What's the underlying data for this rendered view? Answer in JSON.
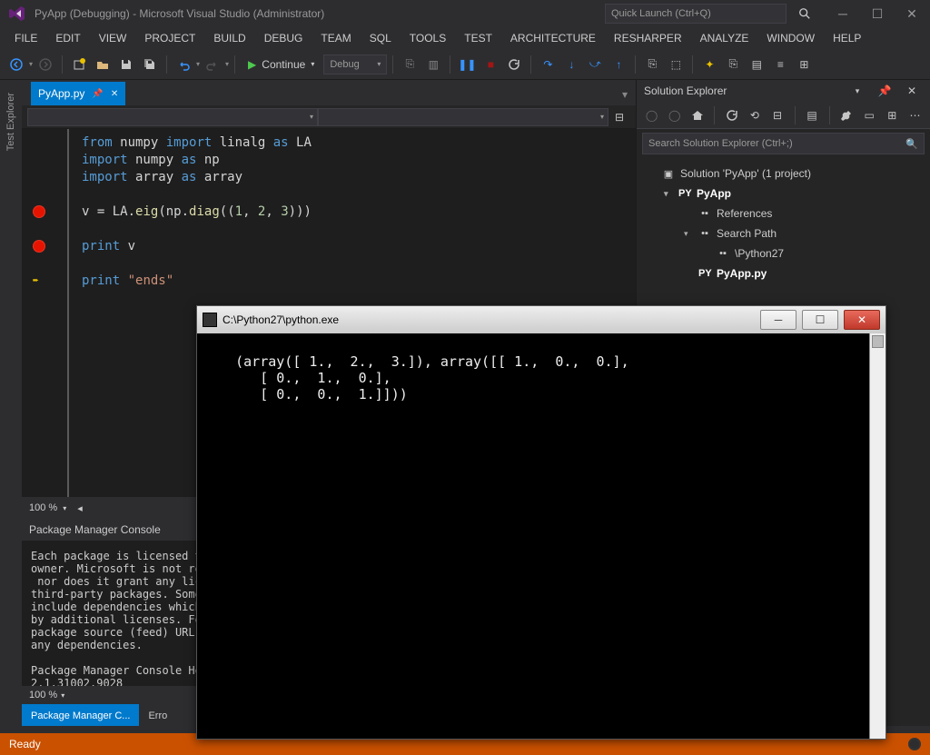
{
  "window": {
    "title": "PyApp (Debugging) - Microsoft Visual Studio (Administrator)",
    "quick_launch_placeholder": "Quick Launch (Ctrl+Q)"
  },
  "menu": [
    "FILE",
    "EDIT",
    "VIEW",
    "PROJECT",
    "BUILD",
    "DEBUG",
    "TEAM",
    "SQL",
    "TOOLS",
    "TEST",
    "ARCHITECTURE",
    "RESHARPER",
    "ANALYZE",
    "WINDOW",
    "HELP"
  ],
  "toolbar": {
    "continue_label": "Continue",
    "config_label": "Debug"
  },
  "left_rail": {
    "tab": "Test Explorer"
  },
  "doc_tab": {
    "label": "PyApp.py"
  },
  "code": {
    "lines": [
      {
        "tokens": [
          [
            "kw",
            "from"
          ],
          [
            "ident",
            " numpy "
          ],
          [
            "kw",
            "import"
          ],
          [
            "ident",
            " linalg "
          ],
          [
            "kw",
            "as"
          ],
          [
            "ident",
            " LA"
          ]
        ]
      },
      {
        "tokens": [
          [
            "kw",
            "import"
          ],
          [
            "ident",
            " numpy "
          ],
          [
            "kw",
            "as"
          ],
          [
            "ident",
            " np"
          ]
        ]
      },
      {
        "tokens": [
          [
            "kw",
            "import"
          ],
          [
            "ident",
            " array "
          ],
          [
            "kw",
            "as"
          ],
          [
            "ident",
            " array"
          ]
        ]
      },
      {
        "tokens": []
      },
      {
        "tokens": [
          [
            "ident",
            "v "
          ],
          [
            "ident",
            "= "
          ],
          [
            "ident",
            "LA"
          ],
          [
            "ident",
            "."
          ],
          [
            "fn",
            "eig"
          ],
          [
            "ident",
            "(np"
          ],
          [
            "ident",
            "."
          ],
          [
            "fn",
            "diag"
          ],
          [
            "ident",
            "(("
          ],
          [
            "num",
            "1"
          ],
          [
            "ident",
            ", "
          ],
          [
            "num",
            "2"
          ],
          [
            "ident",
            ", "
          ],
          [
            "num",
            "3"
          ],
          [
            "ident",
            ")))"
          ]
        ]
      },
      {
        "tokens": []
      },
      {
        "tokens": [
          [
            "kw",
            "print"
          ],
          [
            "ident",
            " v"
          ]
        ]
      },
      {
        "tokens": []
      },
      {
        "tokens": [
          [
            "kw",
            "print"
          ],
          [
            "ident",
            " "
          ],
          [
            "str",
            "\"ends\""
          ]
        ]
      }
    ],
    "breakpoints": [
      4,
      6
    ],
    "current_line": 8
  },
  "zoom": {
    "value": "100 %"
  },
  "pmc": {
    "title": "Package Manager Console",
    "body": "Each package is licensed to you by its\nowner. Microsoft is not responsible for,\n nor does it grant any licenses to,\nthird-party packages. Some packages may\ninclude dependencies which are governed\nby additional licenses. Follow the\npackage source (feed) URL to determine\nany dependencies.\n\nPackage Manager Console Host Version\n2.1.31002.9028",
    "zoom": "100 %"
  },
  "bottom_tabs": [
    "Package Manager C...",
    "Erro"
  ],
  "solution_explorer": {
    "title": "Solution Explorer",
    "search_placeholder": "Search Solution Explorer (Ctrl+;)",
    "tree": [
      {
        "level": 0,
        "arrow": "",
        "icon": "sln",
        "label": "Solution 'PyApp' (1 project)",
        "bold": false
      },
      {
        "level": 1,
        "arrow": "▾",
        "icon": "py",
        "label": "PyApp",
        "bold": true
      },
      {
        "level": 2,
        "arrow": "",
        "icon": "ref",
        "label": "References",
        "bold": false
      },
      {
        "level": 2,
        "arrow": "▾",
        "icon": "ref",
        "label": "Search Path",
        "bold": false
      },
      {
        "level": 3,
        "arrow": "",
        "icon": "ref",
        "label": "\\Python27",
        "bold": false
      },
      {
        "level": 2,
        "arrow": "",
        "icon": "pyf",
        "label": "PyApp.py",
        "bold": true
      }
    ]
  },
  "status": {
    "text": "Ready"
  },
  "console": {
    "title": "C:\\Python27\\python.exe",
    "output": "(array([ 1.,  2.,  3.]), array([[ 1.,  0.,  0.],\n       [ 0.,  1.,  0.],\n       [ 0.,  0.,  1.]]))"
  }
}
